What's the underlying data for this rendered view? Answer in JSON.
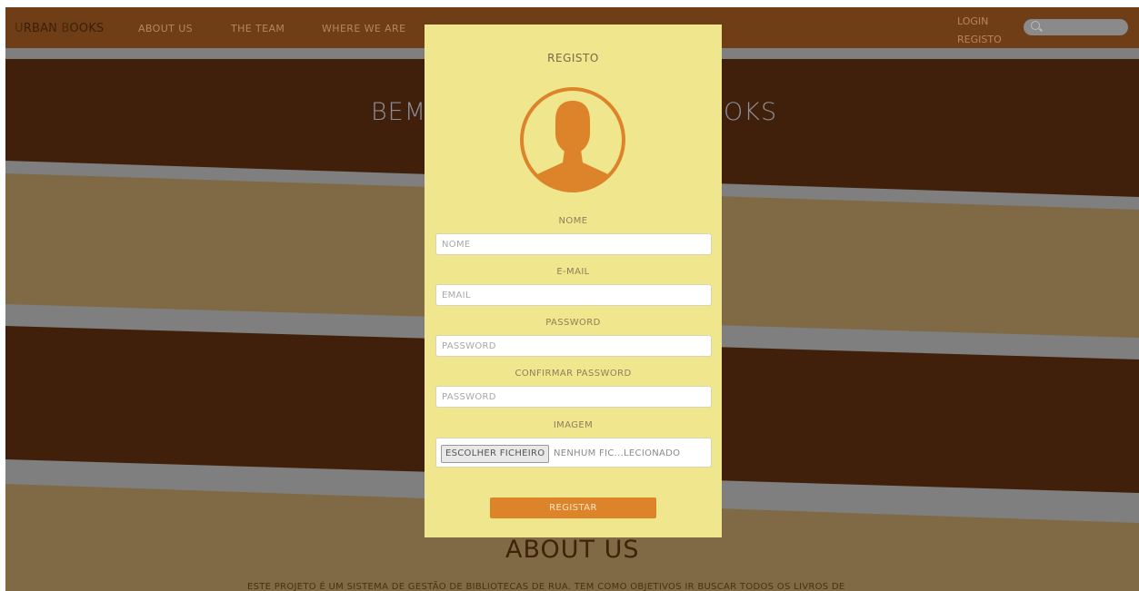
{
  "nav": {
    "brand_first_initial": "U",
    "brand_first_rest": "RBAN",
    "brand_second_initial": "B",
    "brand_second_rest": "OOKS",
    "links": [
      "ABOUT US",
      "THE TEAM",
      "WHERE WE ARE"
    ],
    "login": "LOGIN",
    "register": "REGISTO",
    "search_icon": "search-icon"
  },
  "hero": {
    "welcome_left": "BEM",
    "welcome_right": "OKS"
  },
  "about": {
    "title": "ABOUT US",
    "text": "ESTE PROJETO É UM SISTEMA DE GESTÃO DE BIBLIOTECAS DE RUA. TEM COMO OBJETIVOS IR BUSCAR TODOS OS LIVROS DE"
  },
  "modal": {
    "title": "REGISTO",
    "avatar_icon": "user-avatar-icon",
    "fields": {
      "name_label": "NOME",
      "name_placeholder": "NOME",
      "email_label": "E-MAIL",
      "email_placeholder": "EMAIL",
      "password_label": "PASSWORD",
      "password_placeholder": "PASSWORD",
      "confirm_label": "CONFIRMAR PASSWORD",
      "confirm_placeholder": "PASSWORD",
      "image_label": "IMAGEM",
      "file_button": "ESCOLHER FICHEIRO",
      "file_status": "NENHUM FIC...LECIONADO"
    },
    "submit": "REGISTAR"
  },
  "colors": {
    "modal_bg": "#efe68e",
    "accent": "#dd842b",
    "nav_bg": "#6f3e17"
  }
}
